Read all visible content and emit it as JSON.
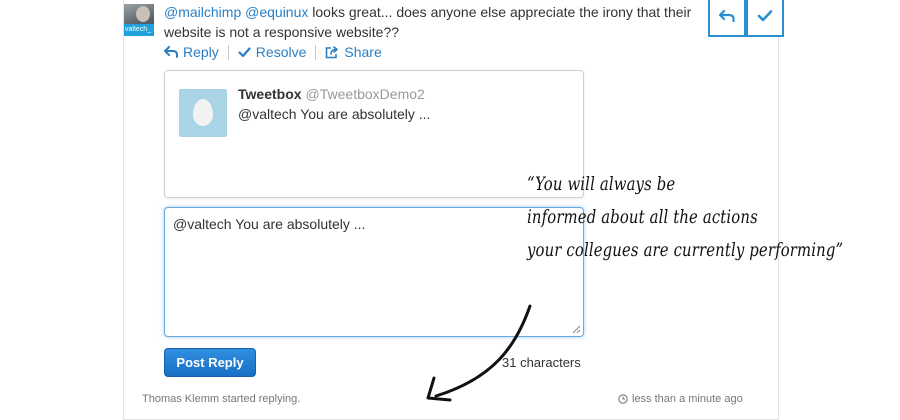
{
  "tweet": {
    "mention1": "@mailchimp",
    "mention2": "@equinux",
    "text": " looks great... does anyone else appreciate the irony that their website is not a responsive website??",
    "avatar_label": "valtech_"
  },
  "actions": {
    "reply": "Reply",
    "resolve": "Resolve",
    "share": "Share"
  },
  "quote": {
    "name": "Tweetbox",
    "handle": "@TweetboxDemo2",
    "text": "@valtech You are absolutely ..."
  },
  "reply": {
    "value": "@valtech You are absolutely ...",
    "button": "Post Reply",
    "char_count": "31 characters"
  },
  "footer": {
    "status": "Thomas Klemm started replying.",
    "time": "less than a minute ago"
  },
  "annotation": {
    "line1": "“You will always be",
    "line2": "informed about all the actions",
    "line3": "your collegues are currently performing”"
  },
  "colors": {
    "accent": "#2a7fc4",
    "button": "#1a6fc4"
  }
}
